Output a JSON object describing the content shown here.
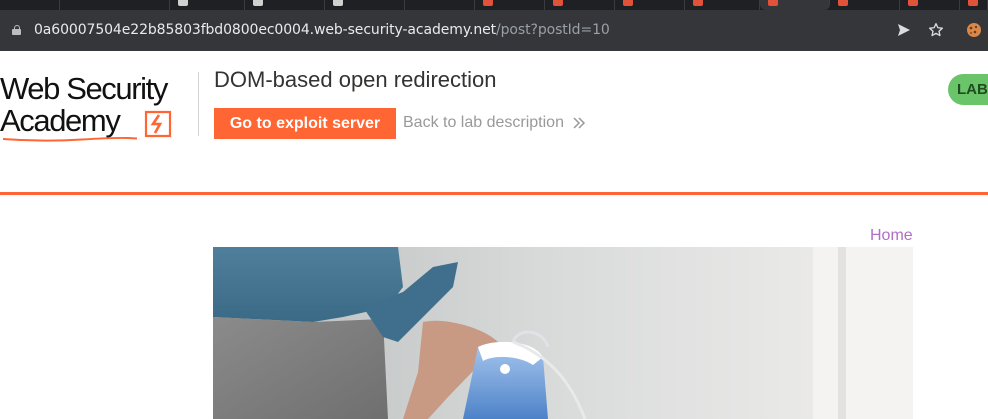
{
  "browser": {
    "url_host": "0a60007504e22b85803fbd0800ec0004.web-security-academy.net",
    "url_path": "/post?postId=10"
  },
  "header": {
    "logo_line1": "Web Security",
    "logo_line2": "Academy",
    "lab_title": "DOM-based open redirection",
    "exploit_button": "Go to exploit server",
    "back_link": "Back to lab description",
    "status_badge": "LAB"
  },
  "nav": {
    "home": "Home"
  },
  "colors": {
    "brand_orange": "#ff6633",
    "status_green": "#6ac46a",
    "link_purple": "#b06ec6",
    "chrome_dark": "#35363a"
  }
}
